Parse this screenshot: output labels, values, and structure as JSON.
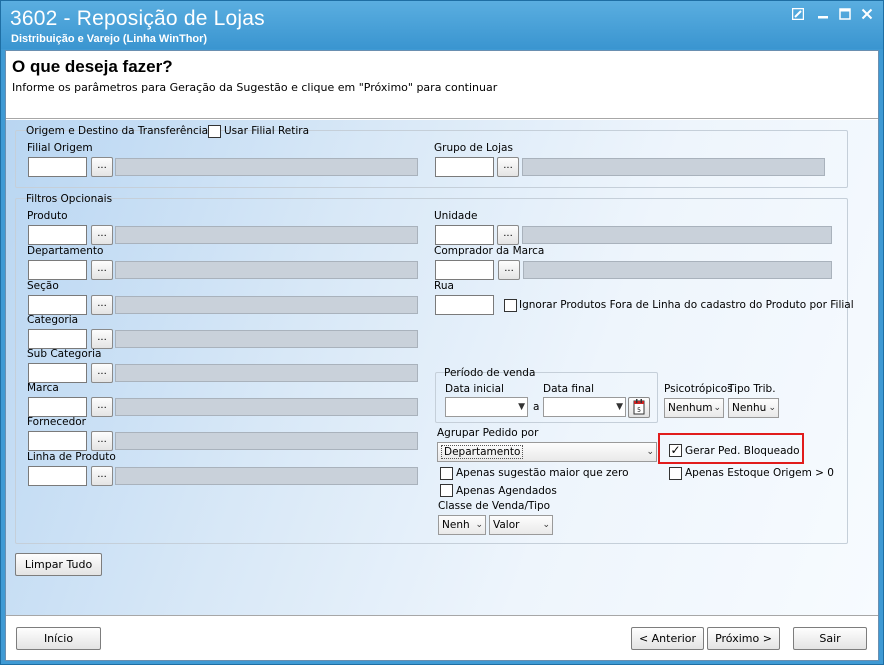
{
  "window": {
    "title": "3602 - Reposição de Lojas",
    "subtitle": "Distribuição e Varejo (Linha WinThor)",
    "controls": [
      "restore",
      "minimize",
      "maximize",
      "close"
    ]
  },
  "header": {
    "title": "O que deseja fazer?",
    "description": "Informe os parâmetros para Geração da Sugestão e clique em \"Próximo\" para continuar"
  },
  "origem": {
    "legend": "Origem e Destino da Transferência",
    "usar_filial_retira": "Usar Filial Retira",
    "filial_origem": "Filial Origem",
    "grupo_lojas": "Grupo de Lojas"
  },
  "filtros": {
    "legend": "Filtros Opcionais",
    "left_fields": [
      "Produto",
      "Departamento",
      "Seção",
      "Categoria",
      "Sub Categoria",
      "Marca",
      "Fornecedor",
      "Linha de Produto"
    ],
    "unidade": "Unidade",
    "comprador": "Comprador da Marca",
    "rua": "Rua",
    "ignorar": "Ignorar Produtos Fora de Linha do cadastro do Produto por Filial",
    "periodo": "Período de venda",
    "data_inicial": "Data inicial",
    "data_final": "Data final",
    "a": "a",
    "psicotropicos": "Psicotrópicos",
    "psicotropicos_value": "Nenhum",
    "tipo_trib": "Tipo Trib.",
    "tipo_trib_value": "Nenhu",
    "agrupar": "Agrupar Pedido por",
    "agrupar_value": "Departamento",
    "gerar_ped": "Gerar Ped. Bloqueado",
    "apenas_sugestao": "Apenas sugestão maior que zero",
    "apenas_estoque": "Apenas Estoque Origem > 0",
    "apenas_agendados": "Apenas Agendados",
    "classe": "Classe de Venda/Tipo",
    "classe_value": "Nenh",
    "tipo_value": "Valor"
  },
  "buttons": {
    "limpar": "Limpar Tudo",
    "inicio": "Início",
    "anterior": "< Anterior",
    "proximo": "Próximo >",
    "sair": "Sair",
    "dots": "..."
  },
  "colors": {
    "titlebar": "#3f9ad4",
    "highlight": "#e11c1c"
  }
}
